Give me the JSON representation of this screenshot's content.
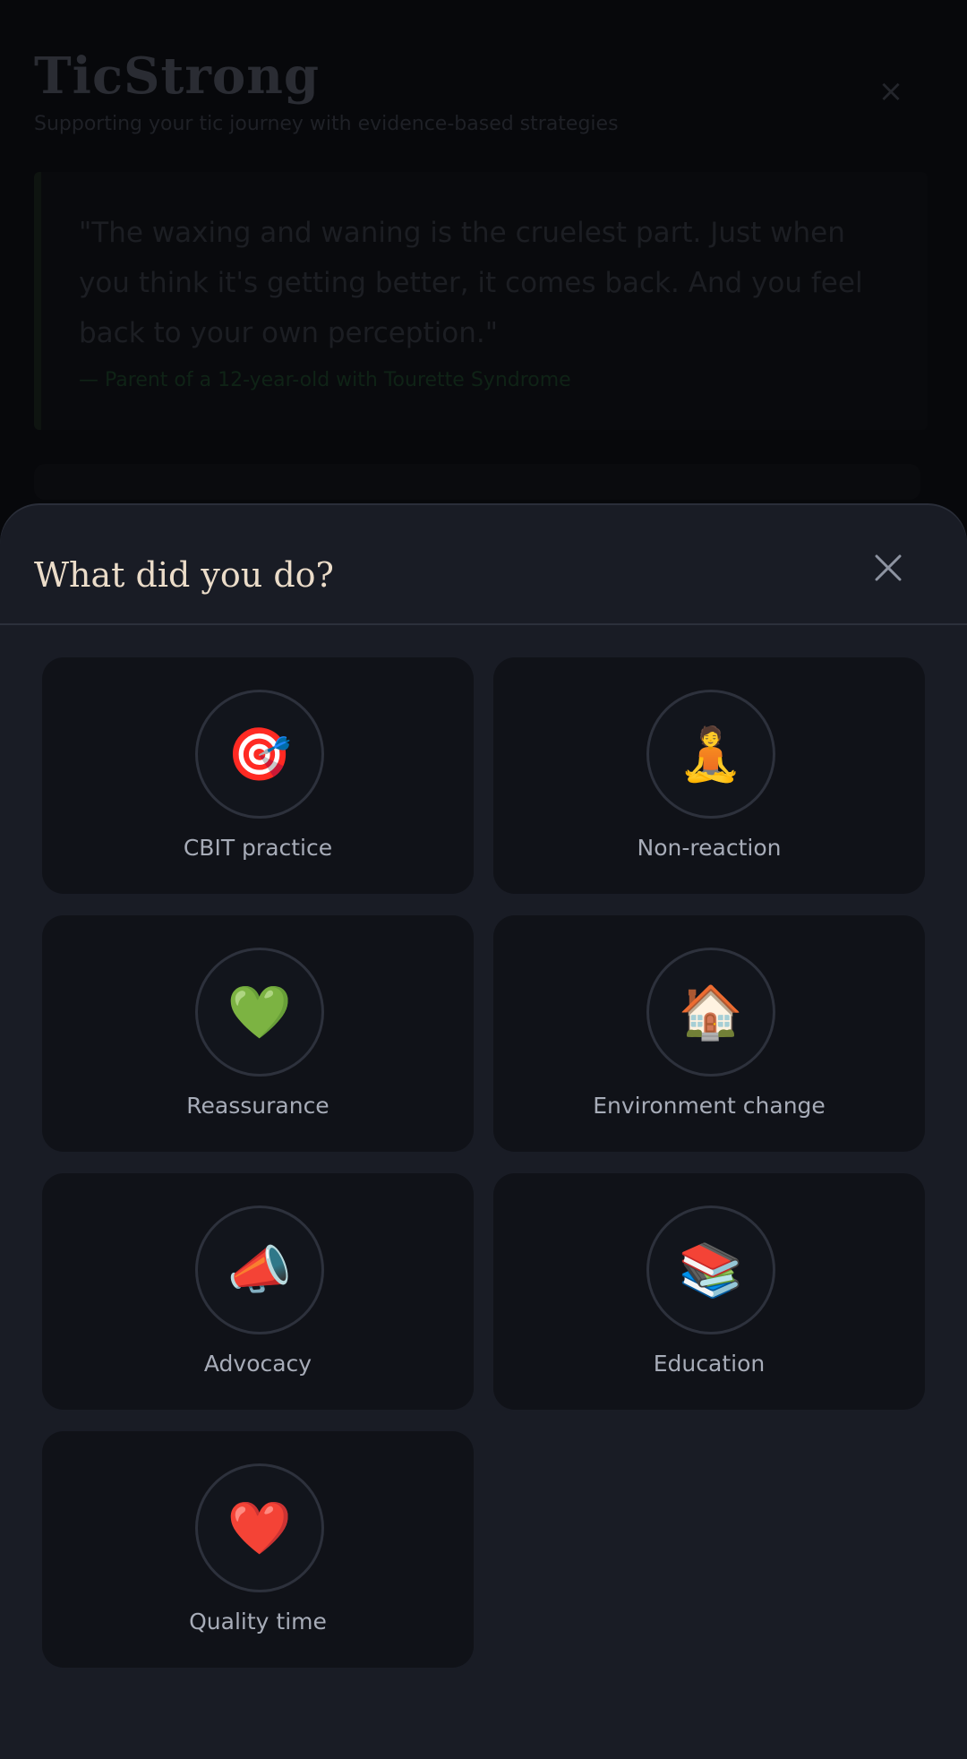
{
  "background": {
    "title": "TicStrong",
    "subtitle": "Supporting your tic journey with evidence-based strategies",
    "close_glyph": "×",
    "quote": "\"The waxing and waning is the cruelest part. Just when you think it's getting better, it comes back. And you feel back to your own perception.\"",
    "attribution": "— Parent of a 12-year-old with Tourette Syndrome"
  },
  "sheet": {
    "title": "What did you do?",
    "close_icon": "close-icon"
  },
  "options": [
    {
      "label": "CBIT practice",
      "emoji": "🎯"
    },
    {
      "label": "Non-reaction",
      "emoji": "🧘"
    },
    {
      "label": "Reassurance",
      "emoji": "💚"
    },
    {
      "label": "Environment change",
      "emoji": "🏠"
    },
    {
      "label": "Advocacy",
      "emoji": "📣"
    },
    {
      "label": "Education",
      "emoji": "📚"
    },
    {
      "label": "Quality time",
      "emoji": "❤️"
    }
  ],
  "colors": {
    "sheet_bg": "#191c25",
    "tile_bg": "#101218",
    "title": "#ebdcc9",
    "label": "#a7acb8"
  }
}
